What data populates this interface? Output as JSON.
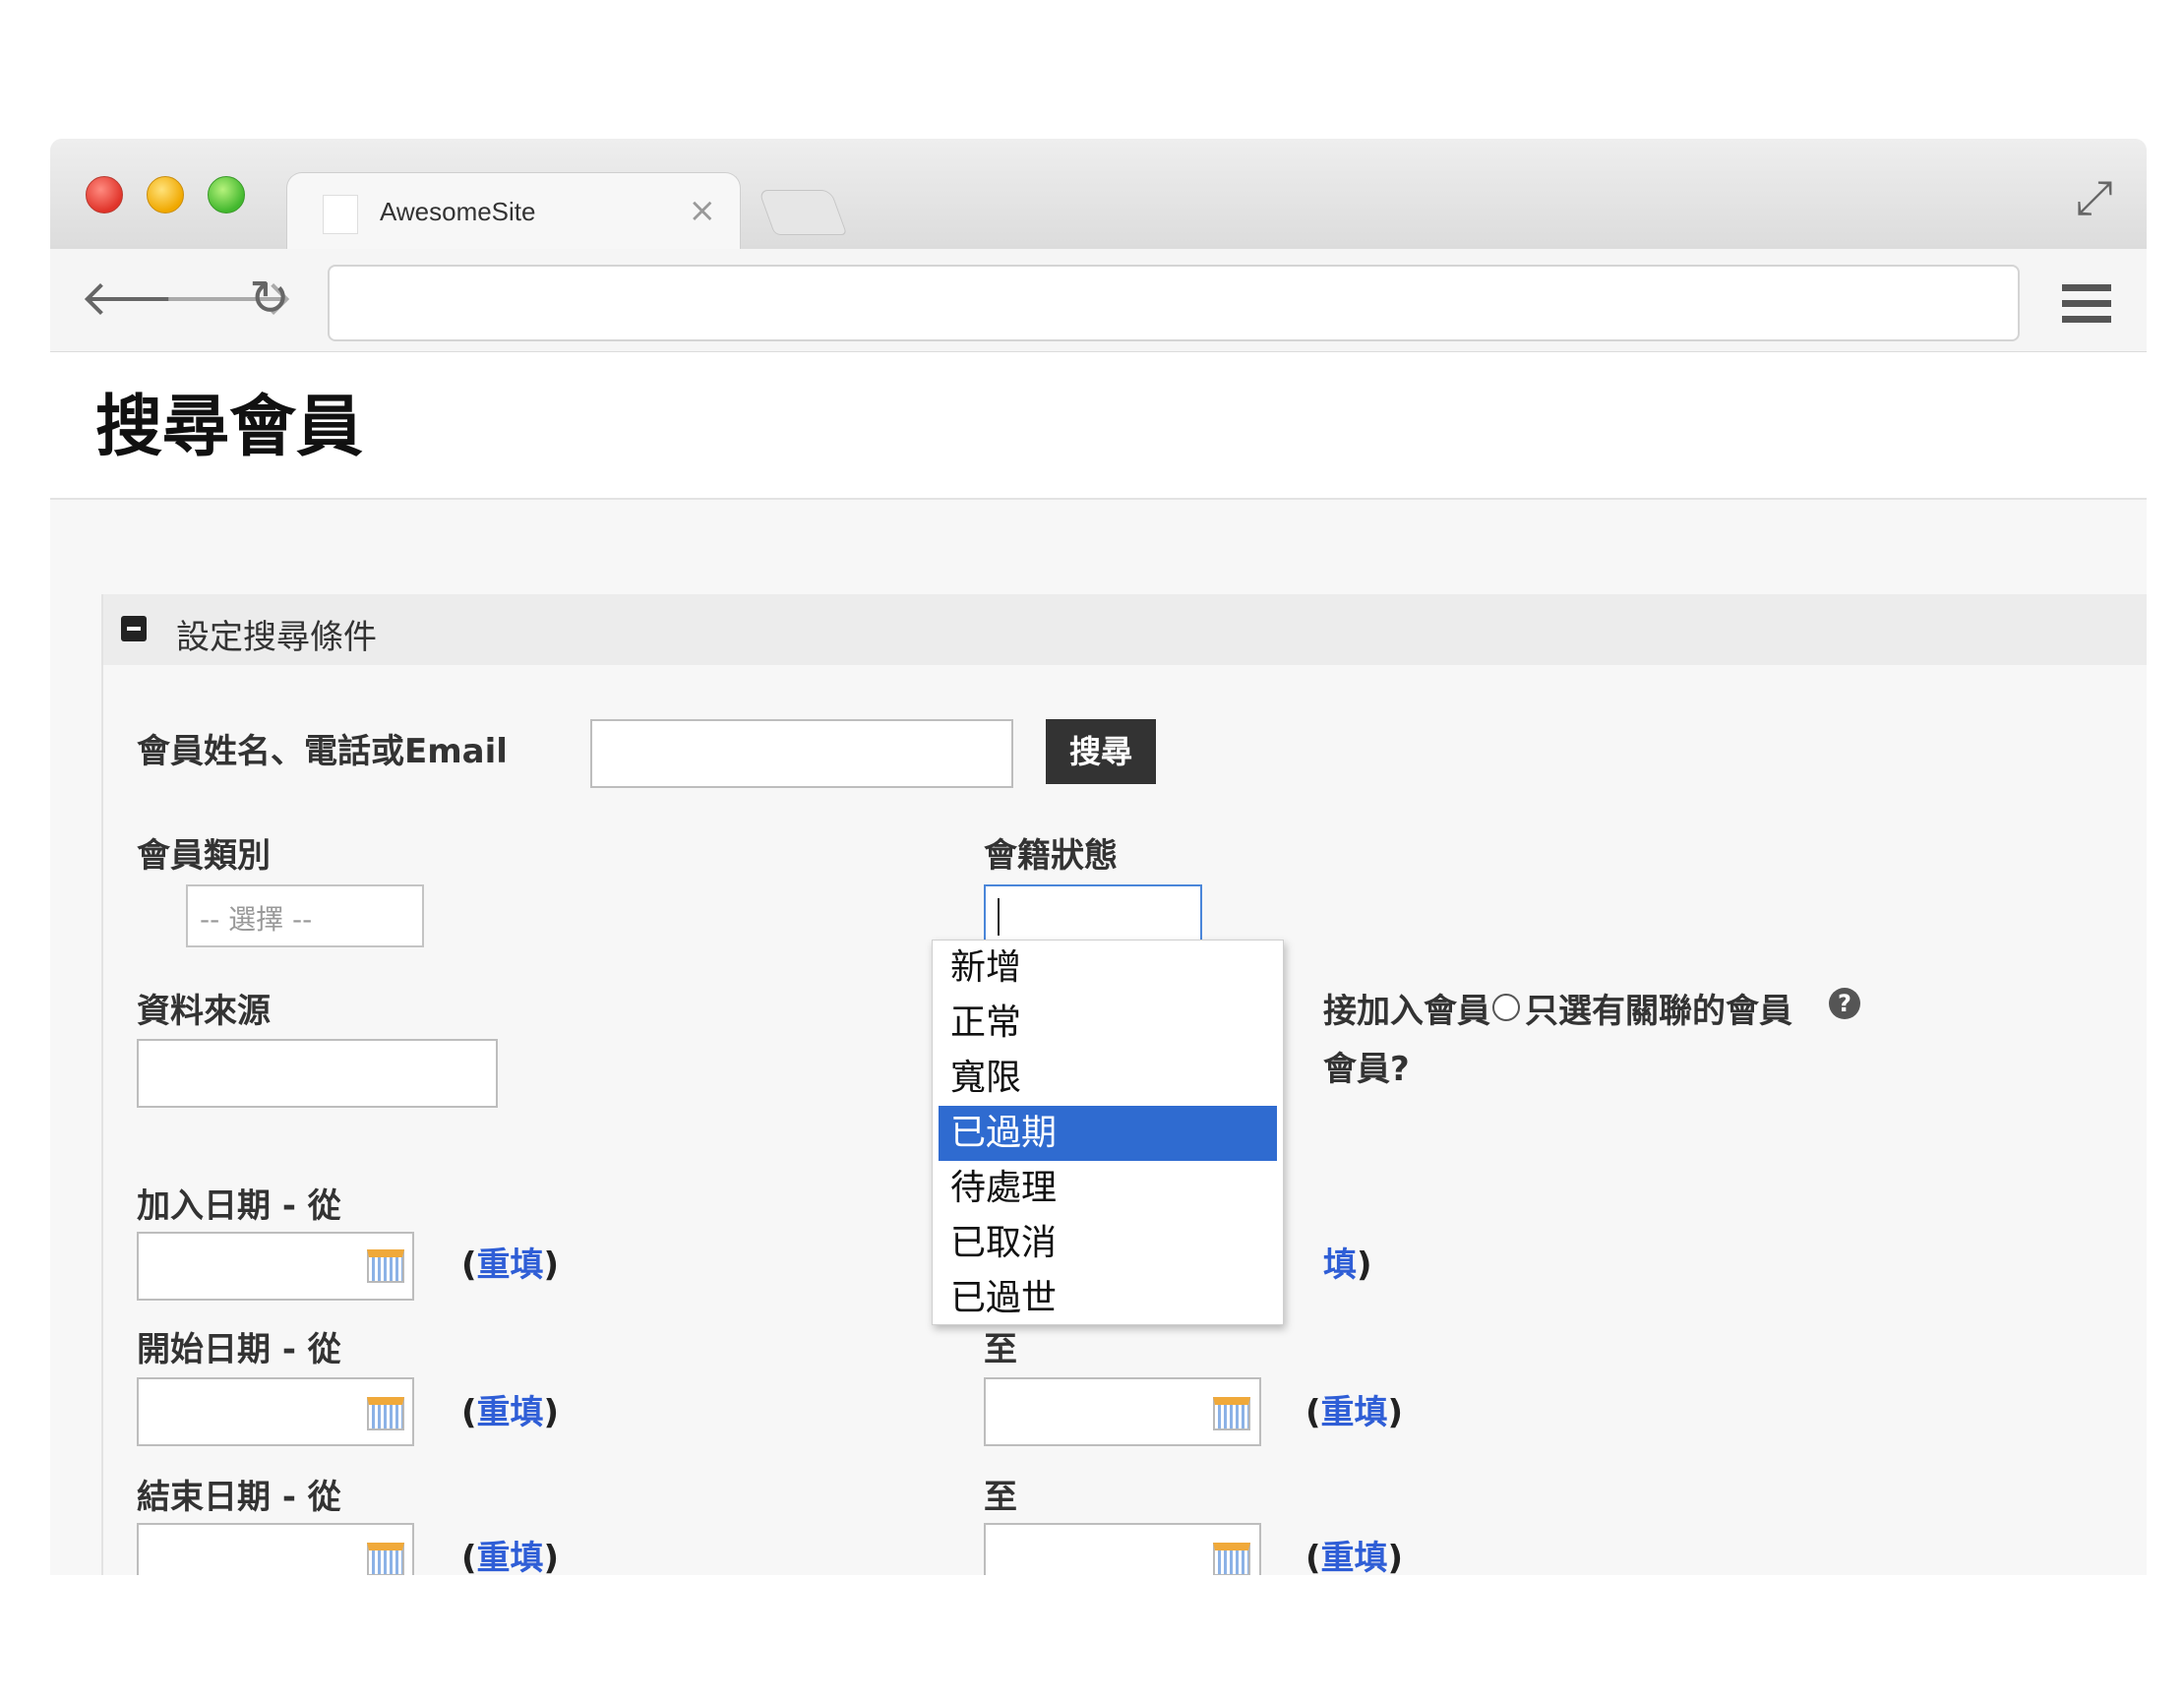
{
  "browser": {
    "tab_title": "AwesomeSite",
    "tab_close": "×",
    "url": ""
  },
  "page": {
    "title": "搜尋會員"
  },
  "panel": {
    "title": "設定搜尋條件"
  },
  "search": {
    "label": "會員姓名、電話或Email",
    "value": "",
    "button_label": "搜尋"
  },
  "member_type": {
    "label": "會員類別",
    "selected": "-- 選擇 --"
  },
  "membership_status": {
    "label": "會籍狀態",
    "value": "",
    "options": [
      "新增",
      "正常",
      "寬限",
      "已過期",
      "待處理",
      "已取消",
      "已過世"
    ],
    "highlighted": "已過期"
  },
  "data_source": {
    "label": "資料來源",
    "value": ""
  },
  "membership_filter": {
    "option_1_partial": "接加入會員",
    "option_2": "只選有關聯的會員",
    "question_partial": "會員?"
  },
  "dates": {
    "join_from_label": "加入日期 - 從",
    "start_from_label": "開始日期 - 從",
    "start_to_label": "至",
    "end_from_label": "結束日期 - 從",
    "end_to_label": "至",
    "reset_open": "(",
    "reset_link": "重填",
    "reset_close": ")",
    "join_to_reset_partial": "填"
  },
  "colors": {
    "link": "#2f5ed6",
    "highlight": "#2f6bd0",
    "button": "#333333"
  }
}
